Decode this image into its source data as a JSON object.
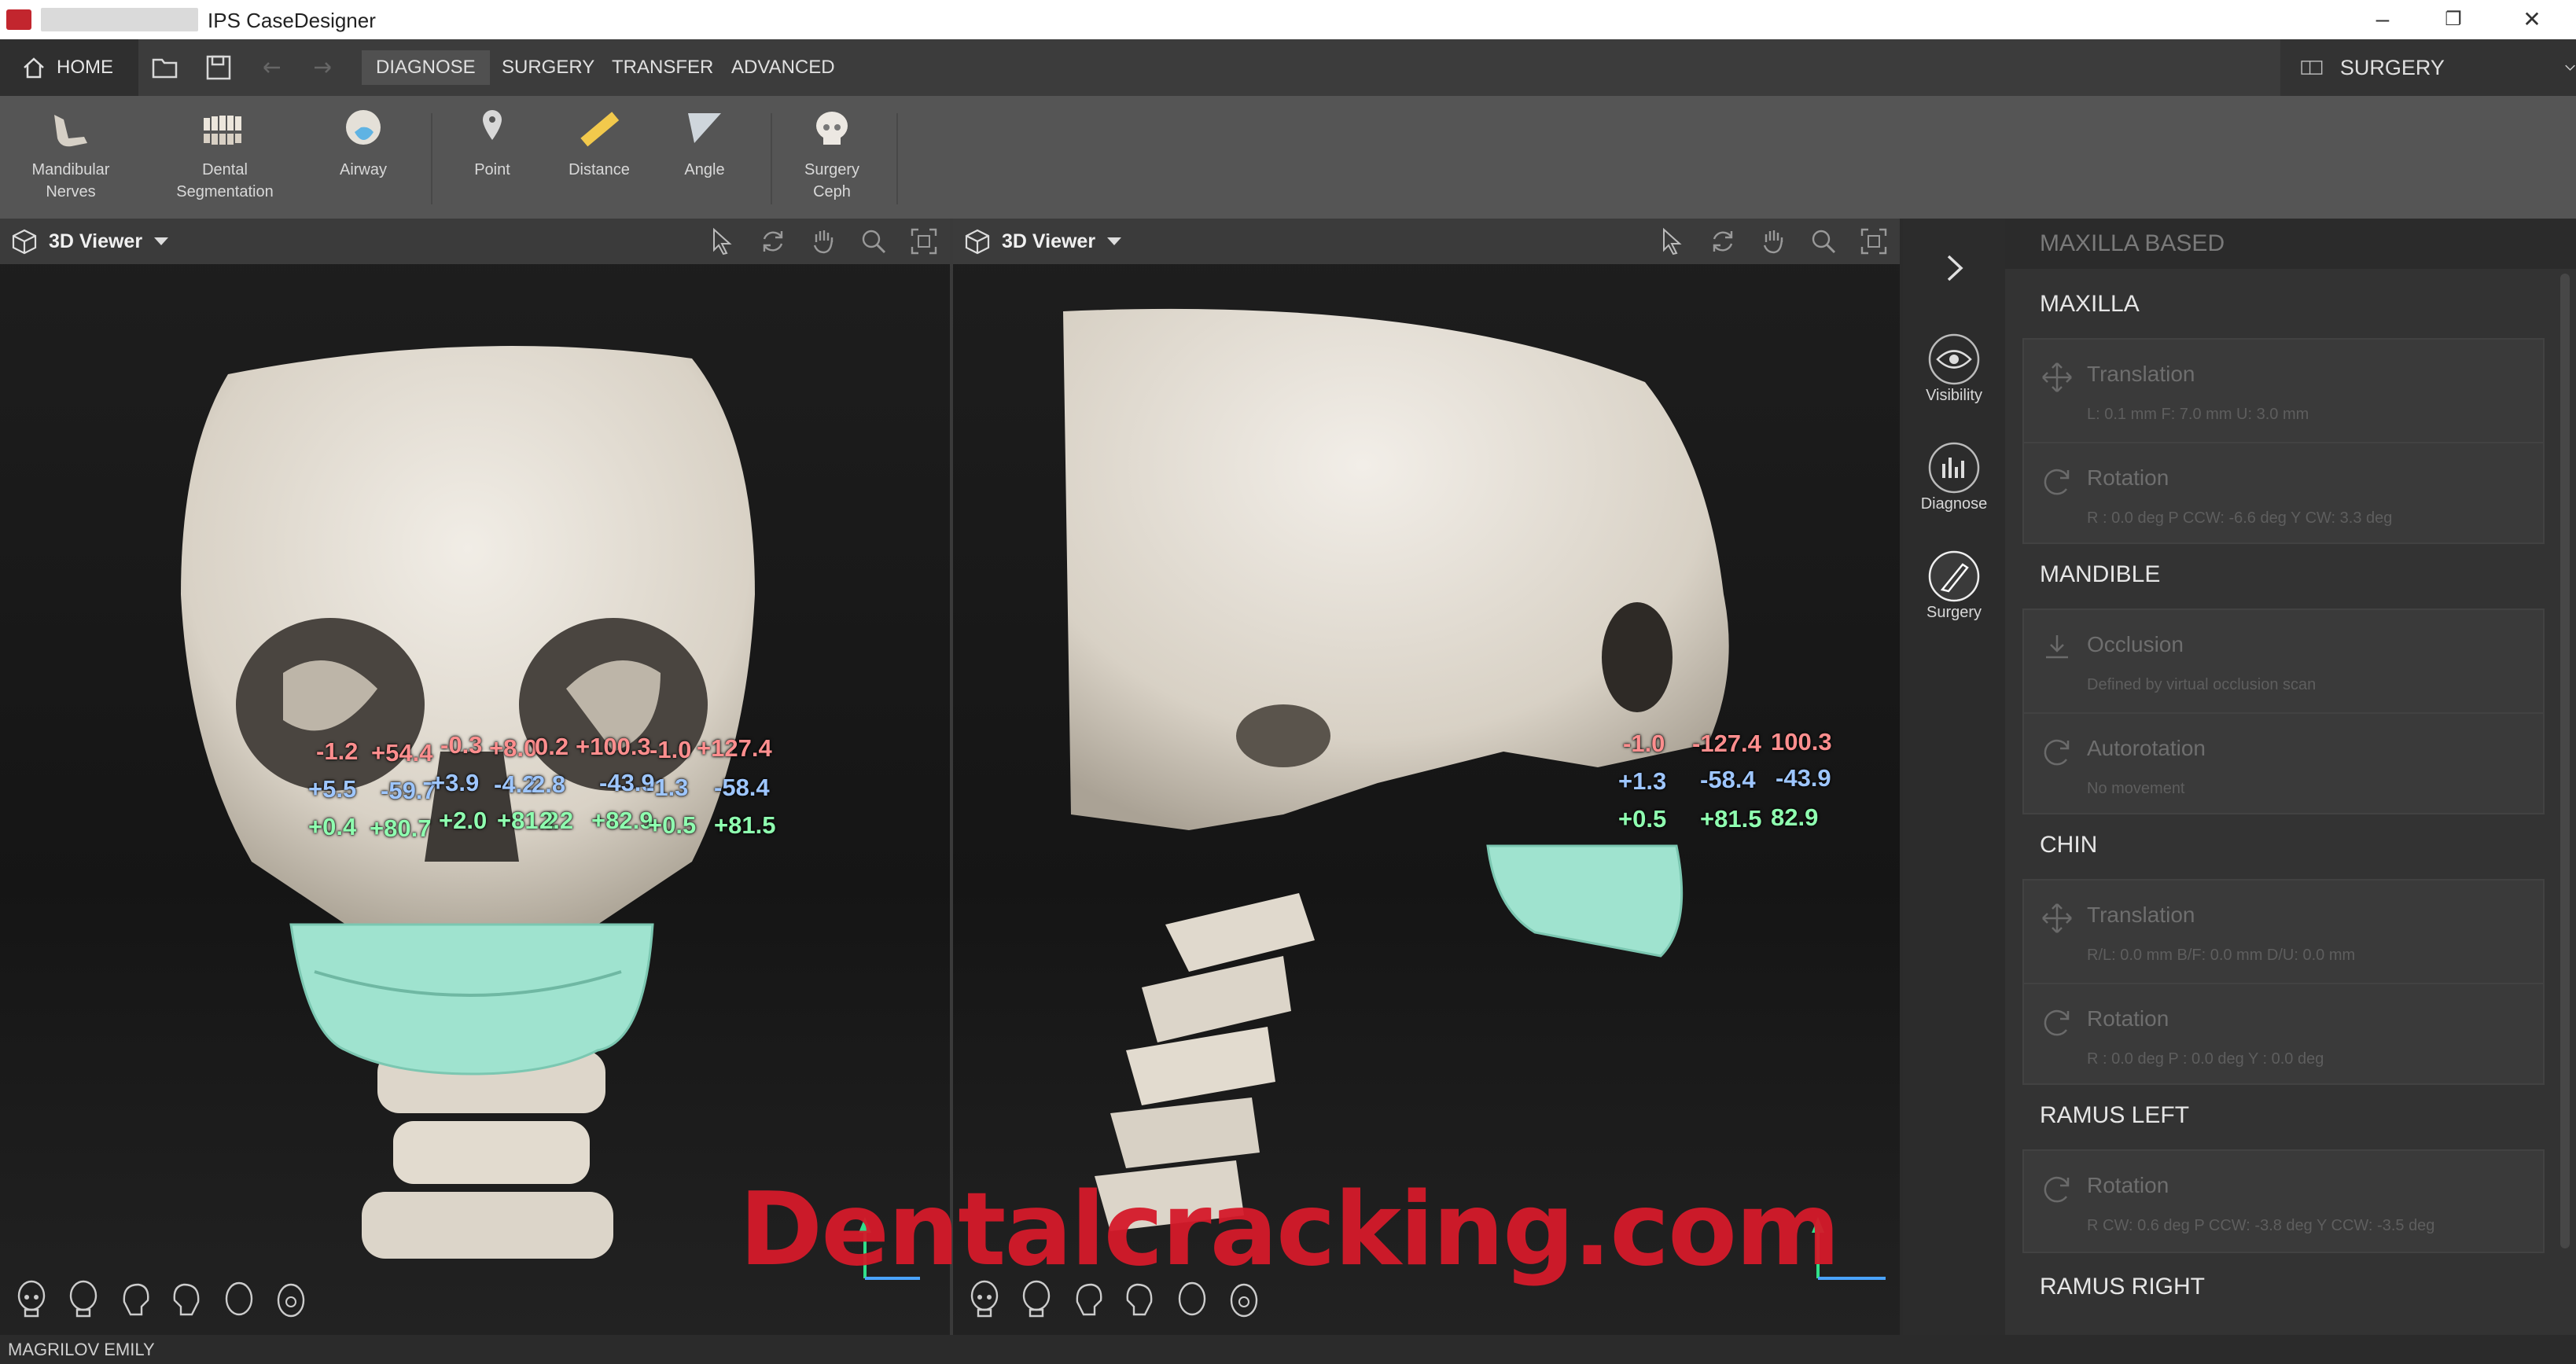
{
  "titlebar": {
    "title": "IPS CaseDesigner",
    "minimize": "–",
    "restore": "❐",
    "close": "✕"
  },
  "menubar": {
    "home_label": "HOME",
    "tabs": [
      {
        "label": "DIAGNOSE",
        "active": true
      },
      {
        "label": "SURGERY",
        "active": false
      },
      {
        "label": "TRANSFER",
        "active": false
      },
      {
        "label": "ADVANCED",
        "active": false
      }
    ],
    "mode": "SURGERY"
  },
  "ribbon": {
    "buttons": [
      {
        "label": "Mandibular\nNerves",
        "icon": "mandible-icon"
      },
      {
        "label": "Dental\nSegmentation",
        "icon": "teeth-icon"
      },
      {
        "label": "Airway",
        "icon": "airway-icon"
      },
      {
        "label": "Point",
        "icon": "point-icon"
      },
      {
        "label": "Distance",
        "icon": "ruler-icon"
      },
      {
        "label": "Angle",
        "icon": "angle-icon"
      },
      {
        "label": "Surgery\nCeph",
        "icon": "ceph-skull-icon"
      }
    ]
  },
  "viewers": {
    "left": {
      "title": "3D Viewer",
      "labels": {
        "r1": [
          "-1.2",
          "+54.4",
          "-0.3",
          "+8.0",
          "0.2",
          "+100.3",
          "-1.0",
          "+127.4"
        ],
        "r2": [
          "+5.5",
          "-59.7",
          "+3.9",
          "-4.2",
          "2.8",
          "-43.9",
          "-1.3",
          "-58.4"
        ],
        "r3": [
          "+0.4",
          "+80.7",
          "+2.0",
          "+81.2",
          "2.2",
          "+82.9",
          "+0.5",
          "+81.5"
        ]
      }
    },
    "right": {
      "title": "3D Viewer",
      "labels": {
        "r1": [
          "-1.0",
          "-127.4",
          "100.3"
        ],
        "r2": [
          "+1.3",
          "-58.4",
          "-43.9"
        ],
        "r3": [
          "+0.5",
          "+81.5",
          "82.9"
        ]
      }
    }
  },
  "watermark": "Dentalcracking.com",
  "side_panel": {
    "items": [
      {
        "label": "Visibility"
      },
      {
        "label": "Diagnose"
      },
      {
        "label": "Surgery"
      }
    ]
  },
  "surgery_panel": {
    "header": "MAXILLA BASED",
    "maxilla": {
      "title": "MAXILLA",
      "translation": {
        "label": "Translation",
        "detail": "L: 0.1 mm     F: 7.0 mm     U: 3.0 mm"
      },
      "rotation": {
        "label": "Rotation",
        "detail": "R : 0.0 deg     P CCW: -6.6 deg     Y CW: 3.3 deg"
      }
    },
    "mandible": {
      "title": "MANDIBLE",
      "occlusion": {
        "label": "Occlusion",
        "detail": "Defined by virtual occlusion scan"
      },
      "autorotation": {
        "label": "Autorotation",
        "detail": "No movement"
      }
    },
    "chin": {
      "title": "CHIN",
      "translation": {
        "label": "Translation",
        "detail": "R/L: 0.0 mm     B/F: 0.0 mm     D/U: 0.0 mm"
      },
      "rotation": {
        "label": "Rotation",
        "detail": "R : 0.0 deg     P : 0.0 deg     Y : 0.0 deg"
      }
    },
    "ramus_left": {
      "title": "RAMUS LEFT",
      "rotation": {
        "label": "Rotation",
        "detail": "R CW: 0.6 deg     P CCW: -3.8 deg     Y CCW: -3.5 deg"
      }
    },
    "ramus_right": {
      "title": "RAMUS RIGHT"
    }
  },
  "statusbar": {
    "patient": "MAGRILOV EMILY"
  },
  "colors": {
    "measure_red": "#ff8e8e",
    "measure_blue": "#9ec6ff",
    "measure_green": "#8fffb0",
    "segment_teal": "#9fe3cf",
    "watermark": "#d51a2a"
  }
}
